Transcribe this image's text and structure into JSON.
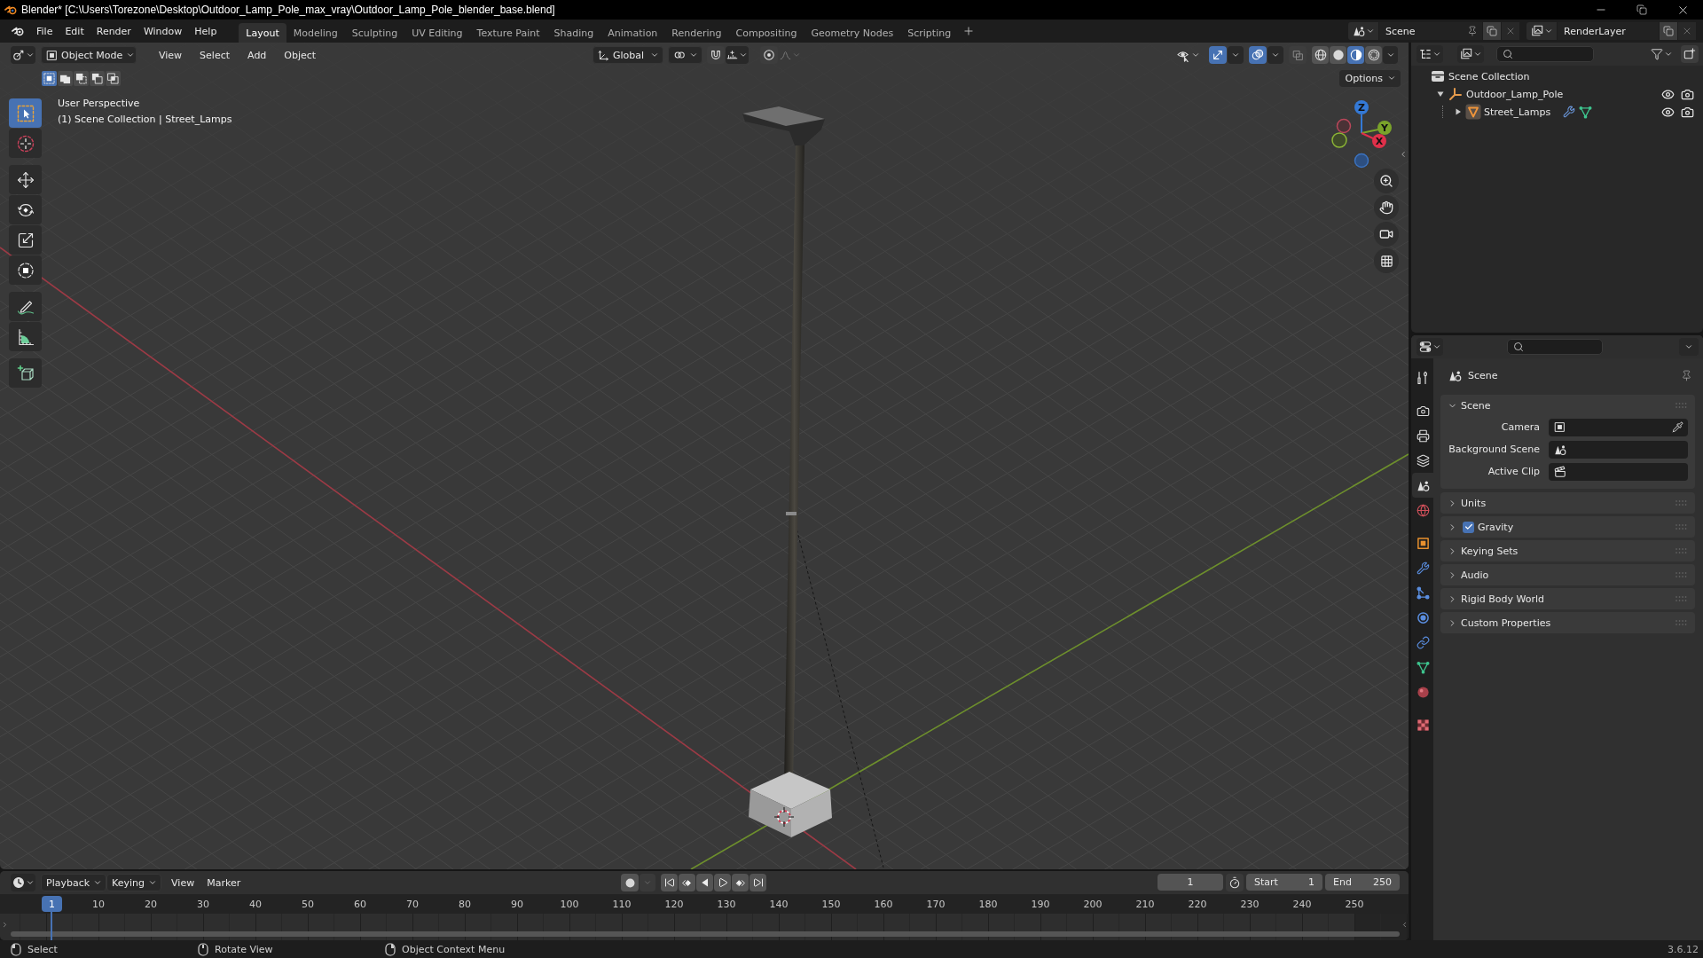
{
  "title_bar": {
    "title": "Blender* [C:\\Users\\Torezone\\Desktop\\Outdoor_Lamp_Pole_max_vray\\Outdoor_Lamp_Pole_blender_base.blend]"
  },
  "top_bar": {
    "menus": [
      "File",
      "Edit",
      "Render",
      "Window",
      "Help"
    ],
    "workspaces": [
      {
        "label": "Layout",
        "selected": true
      },
      {
        "label": "Modeling",
        "selected": false
      },
      {
        "label": "Sculpting",
        "selected": false
      },
      {
        "label": "UV Editing",
        "selected": false
      },
      {
        "label": "Texture Paint",
        "selected": false
      },
      {
        "label": "Shading",
        "selected": false
      },
      {
        "label": "Animation",
        "selected": false
      },
      {
        "label": "Rendering",
        "selected": false
      },
      {
        "label": "Compositing",
        "selected": false
      },
      {
        "label": "Geometry Nodes",
        "selected": false
      },
      {
        "label": "Scripting",
        "selected": false
      }
    ],
    "scene": "Scene",
    "view_layer": "RenderLayer"
  },
  "viewport": {
    "mode": "Object Mode",
    "menus": [
      "View",
      "Select",
      "Add",
      "Object"
    ],
    "orientation": "Global",
    "snap": false,
    "proportional_editing": false,
    "gizmos": true,
    "overlays": true,
    "xray": false,
    "shading": [
      {
        "kind": "wireframe",
        "selected": false
      },
      {
        "kind": "solid",
        "selected": false
      },
      {
        "kind": "material",
        "selected": true
      },
      {
        "kind": "rendered",
        "selected": false
      }
    ],
    "options": "Options",
    "select_modes": [
      {
        "kind": "set",
        "selected": true
      },
      {
        "kind": "extend",
        "selected": false
      },
      {
        "kind": "subtract",
        "selected": false
      },
      {
        "kind": "invert",
        "selected": false
      },
      {
        "kind": "intersect",
        "selected": false
      }
    ],
    "tools": [
      {
        "kind": "select_box",
        "selected": true
      },
      {
        "kind": "cursor",
        "selected": false
      },
      {
        "kind": "move",
        "selected": false
      },
      {
        "kind": "rotate",
        "selected": false
      },
      {
        "kind": "scale",
        "selected": false
      },
      {
        "kind": "transform",
        "selected": false
      },
      {
        "kind": "annotate",
        "selected": false
      },
      {
        "kind": "measure",
        "selected": false
      },
      {
        "kind": "add_cube",
        "selected": false
      }
    ],
    "info": [
      "User Perspective",
      "(1) Scene Collection | Street_Lamps"
    ],
    "axes": [
      "X",
      "Y",
      "Z"
    ]
  },
  "outliner": {
    "tree": [
      {
        "label": "Scene Collection",
        "kind": "scene_collection",
        "children": [
          {
            "label": "Outdoor_Lamp_Pole",
            "kind": "empty",
            "expanded": true,
            "visible": true,
            "renderable": true,
            "children": [
              {
                "label": "Street_Lamps",
                "kind": "mesh",
                "expanded": false,
                "visible": true,
                "renderable": true,
                "badges": [
                  {
                    "kind": "modifier"
                  },
                  {
                    "kind": "mesh_data"
                  }
                ]
              }
            ]
          }
        ]
      }
    ]
  },
  "properties": {
    "tabs": [
      {
        "kind": "tool",
        "selected": false
      },
      {
        "kind": "render",
        "selected": false
      },
      {
        "kind": "output",
        "selected": false
      },
      {
        "kind": "view_layer",
        "selected": false
      },
      {
        "kind": "scene",
        "selected": true
      },
      {
        "kind": "world",
        "selected": false
      },
      {
        "kind": "object",
        "selected": false
      },
      {
        "kind": "modifiers",
        "selected": false
      },
      {
        "kind": "particles",
        "selected": false
      },
      {
        "kind": "physics",
        "selected": false
      },
      {
        "kind": "constraints",
        "selected": false
      },
      {
        "kind": "data",
        "selected": false
      },
      {
        "kind": "material",
        "selected": false
      },
      {
        "kind": "texture",
        "selected": false
      }
    ],
    "context": "Scene",
    "panels": [
      {
        "title": "Scene",
        "kind": "plain",
        "expanded": true,
        "fields": [
          {
            "label": "Camera",
            "kind": "camera"
          },
          {
            "label": "Background Scene",
            "kind": "scene"
          },
          {
            "label": "Active Clip",
            "kind": "clip"
          }
        ]
      },
      {
        "title": "Units",
        "kind": "plain",
        "expanded": false
      },
      {
        "title": "Gravity",
        "kind": "toggle",
        "expanded": false,
        "checked": true
      },
      {
        "title": "Keying Sets",
        "kind": "plain",
        "expanded": false
      },
      {
        "title": "Audio",
        "kind": "plain",
        "expanded": false
      },
      {
        "title": "Rigid Body World",
        "kind": "plain",
        "expanded": false
      },
      {
        "title": "Custom Properties",
        "kind": "plain",
        "expanded": false
      }
    ]
  },
  "timeline": {
    "menus": [
      "Playback",
      "Keying",
      "View",
      "Marker"
    ],
    "auto_keying": false,
    "current_frame": "1",
    "start": {
      "label": "Start",
      "value": "1"
    },
    "end": {
      "label": "End",
      "value": "250"
    },
    "playhead": "1",
    "ticks": [
      "10",
      "20",
      "30",
      "40",
      "50",
      "60",
      "70",
      "80",
      "90",
      "100",
      "110",
      "120",
      "130",
      "140",
      "150",
      "160",
      "170",
      "180",
      "190",
      "200",
      "210",
      "220",
      "230",
      "240",
      "250"
    ]
  },
  "status_bar": {
    "hints": [
      {
        "kind": "left_click",
        "label": "Select"
      },
      {
        "kind": "middle_click",
        "label": "Rotate View"
      },
      {
        "kind": "right_click",
        "label": "Object Context Menu"
      }
    ],
    "version": "3.6.12"
  }
}
